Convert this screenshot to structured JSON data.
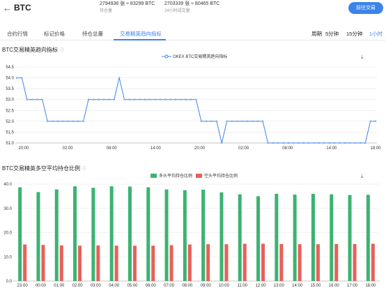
{
  "header": {
    "back_icon": "arrow-left-icon",
    "title": "BTC",
    "open_interest_value": "2794936 张 ≈ 83299 BTC",
    "open_interest_label": "持仓量",
    "volume_value": "2703339 张 ≈ 80465 BTC",
    "volume_label": "24小时成交量",
    "trade_button": "前往交易"
  },
  "tabs": [
    "合约行情",
    "标记价格",
    "持仓总量",
    "交易精英趋向指标"
  ],
  "active_tab": 3,
  "periods": [
    "周期",
    "5分钟",
    "15分钟",
    "1小时"
  ],
  "active_period": 3,
  "chart1": {
    "title": "BTC交易精英趋向指标",
    "info_icon": "info-icon",
    "download_icon": "download-icon",
    "line_color": "#3c84e8"
  },
  "chart2": {
    "title": "BTC交易精英多空平均持仓比例",
    "info_icon": "info-icon",
    "download_icon": "download-icon",
    "colors": {
      "long": "#3cb371",
      "short": "#e8605a"
    }
  },
  "chart_data": [
    {
      "type": "line",
      "title": "BTC交易精英趋向指标",
      "series": [
        {
          "name": "OKEX BTC交易精英趋向指标",
          "values": [
            54.0,
            54.0,
            53.0,
            53.0,
            53.0,
            53.0,
            52.0,
            52.0,
            52.0,
            52.0,
            52.0,
            52.0,
            52.0,
            52.0,
            53.0,
            53.0,
            53.0,
            53.0,
            53.0,
            53.0,
            54.0,
            53.0,
            53.0,
            53.0,
            53.0,
            53.0,
            53.0,
            53.0,
            53.0,
            53.0,
            53.0,
            53.0,
            53.0,
            53.0,
            53.0,
            53.0,
            52.0,
            52.0,
            52.0,
            52.0,
            51.0,
            52.0,
            52.0,
            52.0,
            52.0,
            52.0,
            52.0,
            52.0,
            52.0,
            51.0,
            51.0,
            51.0,
            51.0,
            51.0,
            51.0,
            51.0,
            51.0,
            51.0,
            51.0,
            51.0,
            51.0,
            51.0,
            51.0,
            51.0,
            51.0,
            51.0,
            51.0,
            51.0,
            51.0,
            52.0,
            52.0
          ]
        }
      ],
      "x_ticks": [
        "20:00",
        "02:00",
        "08:00",
        "14:00",
        "20:00",
        "02:00",
        "08:00",
        "14:00",
        "18:00"
      ],
      "y_ticks": [
        "51.0",
        "51.5",
        "52.0",
        "52.5",
        "53.0",
        "53.5",
        "54.0",
        "54.5"
      ],
      "ylim": [
        51.0,
        54.5
      ],
      "grid": true,
      "legend": "top-center"
    },
    {
      "type": "bar",
      "title": "BTC交易精英多空平均持仓比例",
      "categories": [
        "23:00",
        "00:00",
        "01:00",
        "02:00",
        "03:00",
        "04:00",
        "05:00",
        "06:00",
        "07:00",
        "08:00",
        "09:00",
        "10:00",
        "11:00",
        "12:00",
        "13:00",
        "14:00",
        "15:00",
        "16:00",
        "17:00",
        "18:00"
      ],
      "series": [
        {
          "name": "多头平均持仓比例",
          "values": [
            38.7,
            36.7,
            37.8,
            39.1,
            38.5,
            39.1,
            39.0,
            38.7,
            37.8,
            37.5,
            37.7,
            36.6,
            35.8,
            35.0,
            36.0,
            35.7,
            36.0,
            35.8,
            35.5,
            35.6
          ]
        },
        {
          "name": "空头平均持仓比例",
          "values": [
            15.1,
            14.9,
            14.7,
            14.6,
            14.7,
            14.6,
            14.6,
            14.6,
            14.8,
            15.1,
            15.2,
            15.2,
            15.4,
            15.4,
            15.3,
            15.2,
            15.2,
            15.3,
            15.3,
            15.4
          ]
        }
      ],
      "y_ticks": [
        "0.0",
        "10.0",
        "20.0",
        "30.0",
        "40.0"
      ],
      "ylim": [
        0,
        40
      ],
      "grid": true,
      "legend": "top-center"
    }
  ]
}
